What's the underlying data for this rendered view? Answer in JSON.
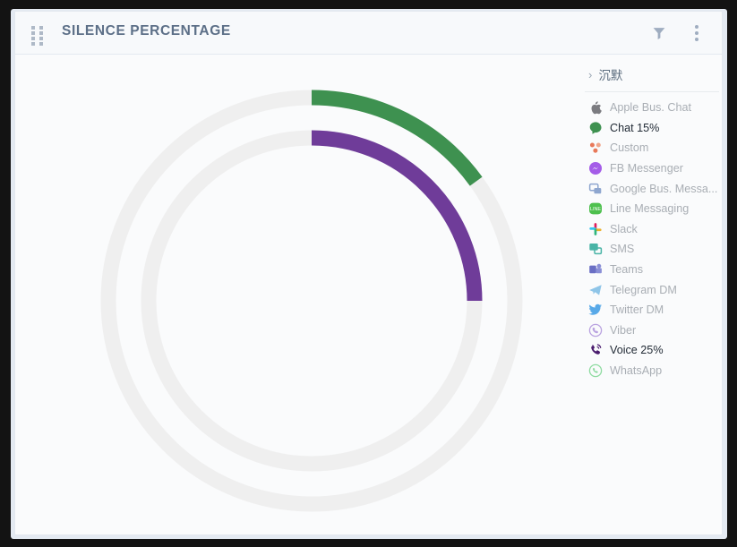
{
  "window": {
    "background_color": "#131313",
    "card_background": "#fafbfc",
    "header_background": "#f7f9fb"
  },
  "header": {
    "title": "SILENCE PERCENTAGE",
    "drag_handle_name": "drag-handle",
    "filter_icon": "filter-icon",
    "menu_icon": "more-vertical-icon"
  },
  "legend": {
    "group_label": "沉默",
    "chevron": "›",
    "items": [
      {
        "label": "Apple Bus. Chat",
        "icon": "apple-icon",
        "color": "#7b7b80",
        "active": false
      },
      {
        "label": "Chat 15%",
        "icon": "chat-bubble-icon",
        "color": "#3e9150",
        "active": true
      },
      {
        "label": "Custom",
        "icon": "custom-dots-icon",
        "color": "#e8795a",
        "active": false
      },
      {
        "label": "FB Messenger",
        "icon": "fb-messenger-icon",
        "color": "#a45ce8",
        "active": false
      },
      {
        "label": "Google Bus. Messa...",
        "icon": "google-chat-icon",
        "color": "#8ea6cf",
        "active": false
      },
      {
        "label": "Line Messaging",
        "icon": "line-icon",
        "color": "#4ec04e",
        "active": false
      },
      {
        "label": "Slack",
        "icon": "slack-icon",
        "color": "#e8a0b4",
        "active": false
      },
      {
        "label": "SMS",
        "icon": "sms-icon",
        "color": "#49b4a6",
        "active": false
      },
      {
        "label": "Teams",
        "icon": "teams-icon",
        "color": "#6a6fc4",
        "active": false
      },
      {
        "label": "Telegram DM",
        "icon": "telegram-icon",
        "color": "#8fc5e8",
        "active": false
      },
      {
        "label": "Twitter DM",
        "icon": "twitter-icon",
        "color": "#58a9e8",
        "active": false
      },
      {
        "label": "Viber",
        "icon": "viber-icon",
        "color": "#b9a2e0",
        "active": false
      },
      {
        "label": "Voice 25%",
        "icon": "voice-phone-icon",
        "color": "#4a1c6e",
        "active": true
      },
      {
        "label": "WhatsApp",
        "icon": "whatsapp-icon",
        "color": "#8edba0",
        "active": false
      }
    ]
  },
  "chart_data": {
    "type": "pie",
    "title": "SILENCE PERCENTAGE",
    "subtype": "concentric-radial-gauge",
    "grid": false,
    "legend_position": "right",
    "track_color": "#efefef",
    "start_angle_deg": 0,
    "direction": "clockwise",
    "center": {
      "x": 331,
      "y": 329
    },
    "series": [
      {
        "name": "Chat",
        "value": 15,
        "unit": "%",
        "color": "#3e9150",
        "ring": "outer",
        "radius": 227,
        "thickness": 17
      },
      {
        "name": "Voice",
        "value": 25,
        "unit": "%",
        "color": "#6f3c99",
        "ring": "inner",
        "radius": 182,
        "thickness": 17
      }
    ],
    "categories": [
      "Chat",
      "Voice"
    ],
    "values": [
      15,
      25
    ],
    "ylim": [
      0,
      100
    ],
    "xlabel": "",
    "ylabel": ""
  }
}
